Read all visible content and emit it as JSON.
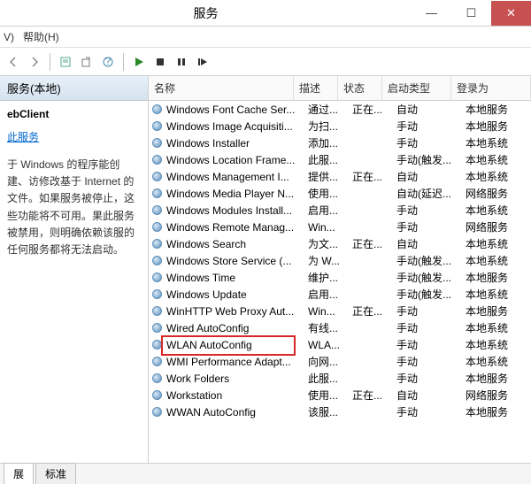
{
  "window": {
    "title": "服务"
  },
  "menu": {
    "view": "V)",
    "help": "帮助(H)"
  },
  "left": {
    "header": "服务(本地)",
    "name": "ebClient",
    "link": "此服务",
    "desc": "于 Windows 的程序能创建、访修改基于 Internet 的文件。如果服务被停止，这些功能将不可用。果此服务被禁用，则明确依赖该服的任何服务都将无法启动。"
  },
  "columns": {
    "name": "名称",
    "desc": "描述",
    "status": "状态",
    "startup": "启动类型",
    "logon": "登录为"
  },
  "services": [
    {
      "name": "Windows Font Cache Ser...",
      "desc": "通过...",
      "status": "正在...",
      "startup": "自动",
      "logon": "本地服务"
    },
    {
      "name": "Windows Image Acquisiti...",
      "desc": "为扫...",
      "status": "",
      "startup": "手动",
      "logon": "本地服务"
    },
    {
      "name": "Windows Installer",
      "desc": "添加...",
      "status": "",
      "startup": "手动",
      "logon": "本地系统"
    },
    {
      "name": "Windows Location Frame...",
      "desc": "此服...",
      "status": "",
      "startup": "手动(触发...",
      "logon": "本地系统"
    },
    {
      "name": "Windows Management I...",
      "desc": "提供...",
      "status": "正在...",
      "startup": "自动",
      "logon": "本地系统"
    },
    {
      "name": "Windows Media Player N...",
      "desc": "使用...",
      "status": "",
      "startup": "自动(延迟...",
      "logon": "网络服务"
    },
    {
      "name": "Windows Modules Install...",
      "desc": "启用...",
      "status": "",
      "startup": "手动",
      "logon": "本地系统"
    },
    {
      "name": "Windows Remote Manag...",
      "desc": "Win...",
      "status": "",
      "startup": "手动",
      "logon": "网络服务"
    },
    {
      "name": "Windows Search",
      "desc": "为文...",
      "status": "正在...",
      "startup": "自动",
      "logon": "本地系统"
    },
    {
      "name": "Windows Store Service (...",
      "desc": "为 W...",
      "status": "",
      "startup": "手动(触发...",
      "logon": "本地系统"
    },
    {
      "name": "Windows Time",
      "desc": "维护...",
      "status": "",
      "startup": "手动(触发...",
      "logon": "本地服务"
    },
    {
      "name": "Windows Update",
      "desc": "启用...",
      "status": "",
      "startup": "手动(触发...",
      "logon": "本地系统"
    },
    {
      "name": "WinHTTP Web Proxy Aut...",
      "desc": "Win...",
      "status": "正在...",
      "startup": "手动",
      "logon": "本地服务"
    },
    {
      "name": "Wired AutoConfig",
      "desc": "有线...",
      "status": "",
      "startup": "手动",
      "logon": "本地系统"
    },
    {
      "name": "WLAN AutoConfig",
      "desc": "WLA...",
      "status": "",
      "startup": "手动",
      "logon": "本地系统",
      "hl": true
    },
    {
      "name": "WMI Performance Adapt...",
      "desc": "向网...",
      "status": "",
      "startup": "手动",
      "logon": "本地系统"
    },
    {
      "name": "Work Folders",
      "desc": "此服...",
      "status": "",
      "startup": "手动",
      "logon": "本地服务"
    },
    {
      "name": "Workstation",
      "desc": "使用...",
      "status": "正在...",
      "startup": "自动",
      "logon": "网络服务"
    },
    {
      "name": "WWAN AutoConfig",
      "desc": "该服...",
      "status": "",
      "startup": "手动",
      "logon": "本地服务"
    }
  ],
  "tabs": {
    "ext": "展",
    "std": "标准"
  }
}
